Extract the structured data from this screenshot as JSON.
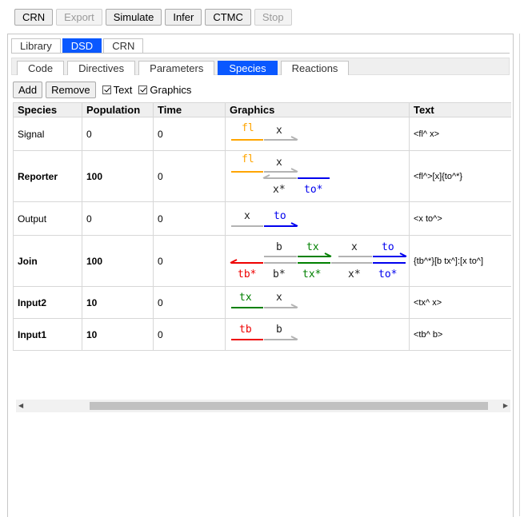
{
  "toolbar": {
    "buttons": [
      {
        "label": "CRN",
        "enabled": true
      },
      {
        "label": "Export",
        "enabled": false
      },
      {
        "label": "Simulate",
        "enabled": true
      },
      {
        "label": "Infer",
        "enabled": true
      },
      {
        "label": "CTMC",
        "enabled": true
      },
      {
        "label": "Stop",
        "enabled": false
      }
    ]
  },
  "main_tabs": [
    {
      "label": "Library",
      "active": false
    },
    {
      "label": "DSD",
      "active": true
    },
    {
      "label": "CRN",
      "active": false
    }
  ],
  "sub_tabs": [
    {
      "label": "Code",
      "active": false
    },
    {
      "label": "Directives",
      "active": false
    },
    {
      "label": "Parameters",
      "active": false
    },
    {
      "label": "Species",
      "active": true
    },
    {
      "label": "Reactions",
      "active": false
    }
  ],
  "actions": {
    "add_label": "Add",
    "remove_label": "Remove",
    "text_checkbox": {
      "label": "Text",
      "checked": true
    },
    "graphics_checkbox": {
      "label": "Graphics",
      "checked": true
    }
  },
  "table": {
    "headers": [
      "Species",
      "Population",
      "Time",
      "Graphics",
      "Text"
    ],
    "rows": [
      {
        "species": "Signal",
        "population": "0",
        "time": "0",
        "text": "<fl^ x>",
        "bold": false
      },
      {
        "species": "Reporter",
        "population": "100",
        "time": "0",
        "text": "<fl^>[x]{to^*}",
        "bold": true
      },
      {
        "species": "Output",
        "population": "0",
        "time": "0",
        "text": "<x to^>",
        "bold": false
      },
      {
        "species": "Join",
        "population": "100",
        "time": "0",
        "text": "{tb^*}[b tx^]:[x to^]",
        "bold": true
      },
      {
        "species": "Input2",
        "population": "10",
        "time": "0",
        "text": "<tx^ x>",
        "bold": true
      },
      {
        "species": "Input1",
        "population": "10",
        "time": "0",
        "text": "<tb^ b>",
        "bold": true
      }
    ]
  },
  "graphics": {
    "colors": {
      "fl": "#ffa500",
      "grey": "#b3b3b3",
      "to": "#0000ee",
      "tx": "#008000",
      "tb": "#ee0000",
      "text_dark": "#222222"
    },
    "signal": {
      "top": [
        {
          "label": "fl",
          "color": "fl"
        },
        {
          "label": "x",
          "color": "grey",
          "arrow": true
        }
      ]
    },
    "reporter": {
      "top": [
        {
          "label": "fl",
          "color": "fl"
        },
        {
          "label": "x",
          "color": "grey",
          "arrow": true
        }
      ],
      "bottom": [
        {
          "label": "x*",
          "color": "grey",
          "arrow": true
        },
        {
          "label": "to*",
          "color": "to"
        }
      ]
    },
    "output": {
      "top": [
        {
          "label": "x",
          "color": "grey"
        },
        {
          "label": "to",
          "color": "to",
          "arrow": true
        }
      ]
    },
    "join": {
      "left": {
        "top": [
          {
            "label": "b",
            "color": "grey"
          },
          {
            "label": "tx",
            "color": "tx",
            "arrow": true
          }
        ],
        "bottom": [
          {
            "label": "tb*",
            "color": "tb",
            "arrow": true
          },
          {
            "label": "b*",
            "color": "grey"
          },
          {
            "label": "tx*",
            "color": "tx"
          }
        ]
      },
      "right": {
        "top": [
          {
            "label": "x",
            "color": "grey"
          },
          {
            "label": "to",
            "color": "to",
            "arrow": true
          }
        ],
        "bottom": [
          {
            "label": "x*",
            "color": "grey"
          },
          {
            "label": "to*",
            "color": "to"
          }
        ]
      }
    },
    "input2": {
      "top": [
        {
          "label": "tx",
          "color": "tx"
        },
        {
          "label": "x",
          "color": "grey",
          "arrow": true
        }
      ]
    },
    "input1": {
      "top": [
        {
          "label": "tb",
          "color": "tb"
        },
        {
          "label": "b",
          "color": "grey",
          "arrow": true
        }
      ]
    }
  }
}
